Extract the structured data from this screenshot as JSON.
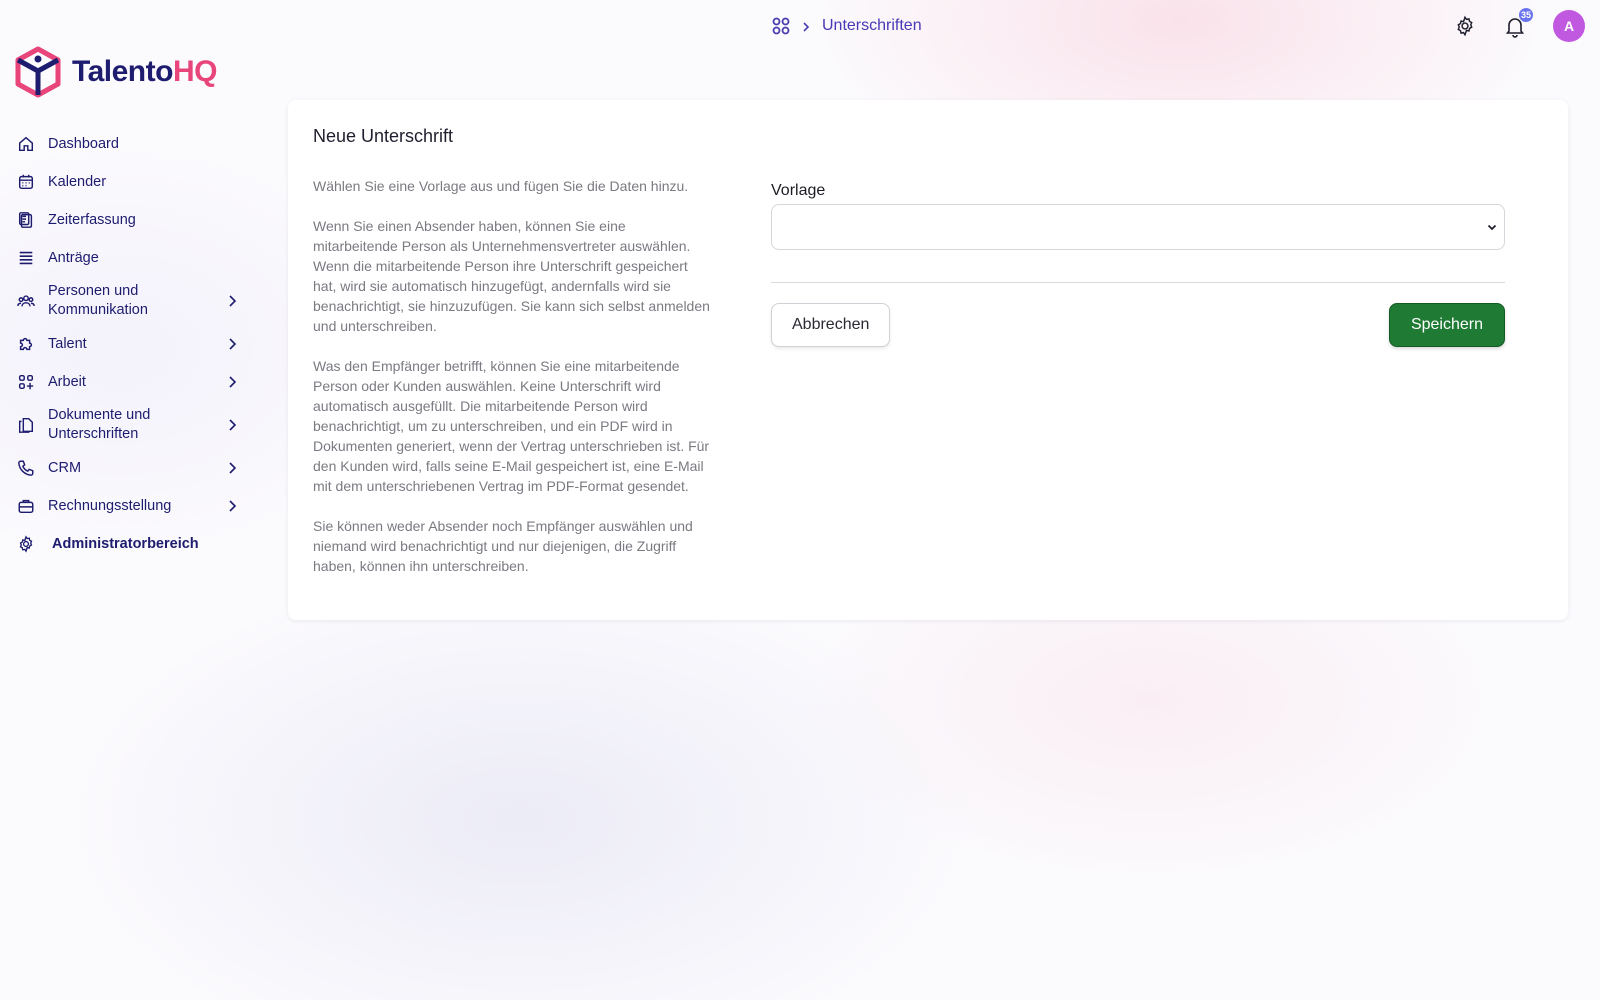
{
  "header": {
    "breadcrumb_label": "Unterschriften",
    "notification_count": "35",
    "avatar_initial": "A"
  },
  "brand": {
    "name_part1": "Talento",
    "name_part2": "HQ",
    "accent_color": "#e8457a",
    "primary_color": "#1d1c6e"
  },
  "sidebar": {
    "items": [
      {
        "label": "Dashboard",
        "icon": "home-icon"
      },
      {
        "label": "Kalender",
        "icon": "calendar-icon"
      },
      {
        "label": "Zeiterfassung",
        "icon": "clipboard-icon"
      },
      {
        "label": "Anträge",
        "icon": "list-icon"
      },
      {
        "label": "Personen und Kommunikation",
        "icon": "users-icon"
      },
      {
        "label": "Talent",
        "icon": "puzzle-icon"
      },
      {
        "label": "Arbeit",
        "icon": "apps-plus-icon"
      },
      {
        "label": "Dokumente und Unterschriften",
        "icon": "documents-icon"
      },
      {
        "label": "CRM",
        "icon": "phone-icon"
      },
      {
        "label": "Rechnungsstellung",
        "icon": "briefcase-icon"
      },
      {
        "label": "Administratorbereich",
        "icon": "gear-icon"
      }
    ]
  },
  "card": {
    "title": "Neue Unterschrift",
    "paragraphs": [
      "Wählen Sie eine Vorlage aus und fügen Sie die Daten hinzu.",
      "Wenn Sie einen Absender haben, können Sie eine mitarbeitende Person als Unternehmensvertreter auswählen. Wenn die mitarbeitende Person ihre Unterschrift gespeichert hat, wird sie automatisch hinzugefügt, andernfalls wird sie benachrichtigt, sie hinzuzufügen. Sie kann sich selbst anmelden und unterschreiben.",
      "Was den Empfänger betrifft, können Sie eine mitarbeitende Person oder Kunden auswählen. Keine Unterschrift wird automatisch ausgefüllt. Die mitarbeitende Person wird benachrichtigt, um zu unterschreiben, und ein PDF wird in Dokumenten generiert, wenn der Vertrag unterschrieben ist. Für den Kunden wird, falls seine E-Mail gespeichert ist, eine E-Mail mit dem unterschriebenen Vertrag im PDF-Format gesendet.",
      "Sie können weder Absender noch Empfänger auswählen und niemand wird benachrichtigt und nur diejenigen, die Zugriff haben, können ihn unterschreiben."
    ],
    "form": {
      "template_label": "Vorlage",
      "template_value": "",
      "cancel_label": "Abbrechen",
      "save_label": "Speichern",
      "save_color": "#1f7a34"
    }
  }
}
